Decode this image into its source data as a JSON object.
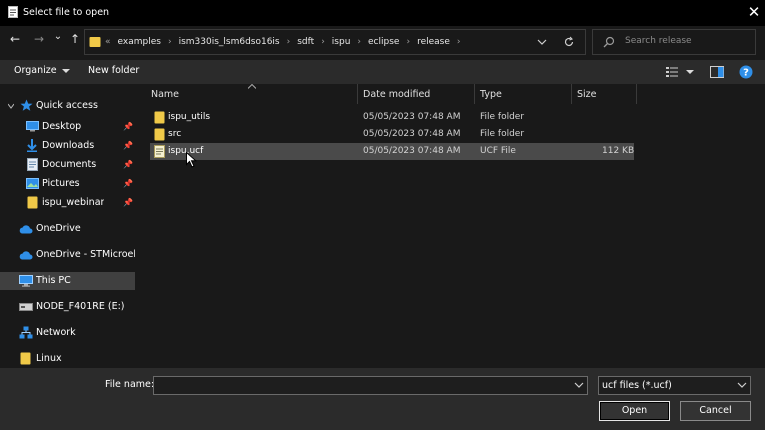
{
  "window": {
    "title": "Select file to open",
    "close_glyph": "✕"
  },
  "nav": {
    "back": "←",
    "forward": "→",
    "recent": "⌄",
    "up": "↑",
    "crumbs": [
      "examples",
      "ism330is_lsm6dso16is",
      "sdft",
      "ispu",
      "eclipse",
      "release"
    ],
    "search_placeholder": "Search release"
  },
  "toolbar": {
    "organize": "Organize",
    "new_folder": "New folder"
  },
  "sidebar": {
    "quick_access": "Quick access",
    "items": [
      {
        "label": "Desktop",
        "pinned": true
      },
      {
        "label": "Downloads",
        "pinned": true
      },
      {
        "label": "Documents",
        "pinned": true
      },
      {
        "label": "Pictures",
        "pinned": true
      },
      {
        "label": "ispu_webinar",
        "pinned": true
      }
    ],
    "onedrive": "OneDrive",
    "onedrive_st": "OneDrive - STMicroelec",
    "this_pc": "This PC",
    "drive": "NODE_F401RE (E:)",
    "network": "Network",
    "linux": "Linux"
  },
  "columns": {
    "name": "Name",
    "date": "Date modified",
    "type": "Type",
    "size": "Size"
  },
  "files": [
    {
      "name": "ispu_utils",
      "date": "05/05/2023 07:48 AM",
      "type": "File folder",
      "size": "",
      "icon": "folder-icon"
    },
    {
      "name": "src",
      "date": "05/05/2023 07:48 AM",
      "type": "File folder",
      "size": "",
      "icon": "folder-icon"
    },
    {
      "name": "ispu.ucf",
      "date": "05/05/2023 07:48 AM",
      "type": "UCF File",
      "size": "112 KB",
      "icon": "document-icon"
    }
  ],
  "footer": {
    "file_name_label": "File name:",
    "file_name_value": "",
    "filter": "ucf files (*.ucf)",
    "open": "Open",
    "cancel": "Cancel"
  },
  "colors": {
    "folder": "#f0c948",
    "accent_blue": "#2f8fe8",
    "selected_row": "#4a4a4a"
  }
}
